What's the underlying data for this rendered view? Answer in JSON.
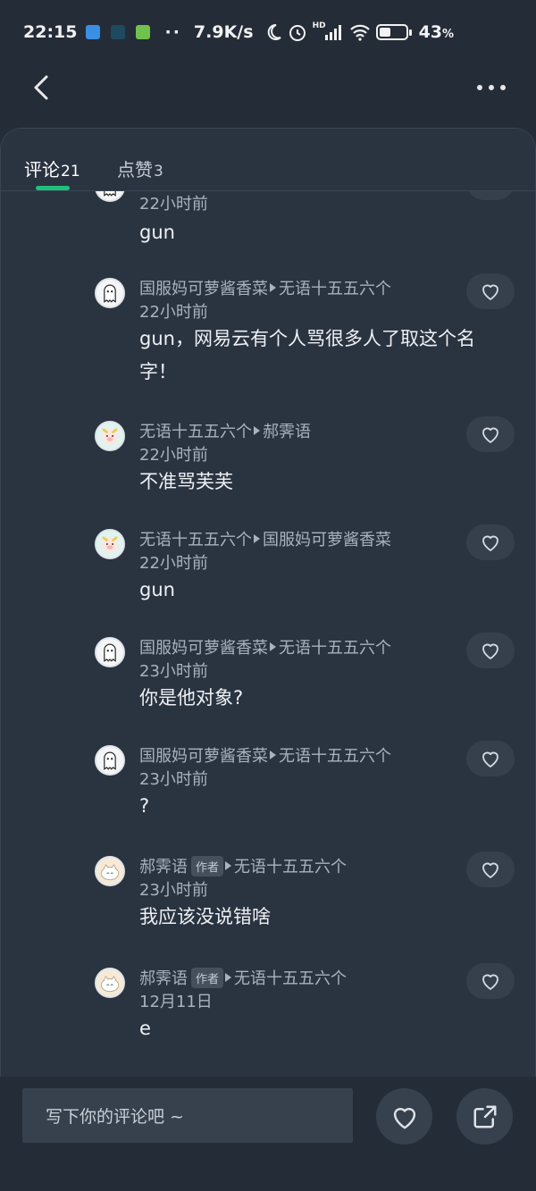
{
  "status_bar": {
    "time": "22:15",
    "net_speed": "7.9K/s",
    "battery_percent": "43",
    "battery_level": 0.43,
    "battery_suffix": "%",
    "hd_label": "HD",
    "icons": [
      "app-icon-1",
      "app-icon-2",
      "app-icon-3",
      "dots",
      "moon-icon",
      "alarm-icon",
      "signal-icon",
      "wifi-icon",
      "battery-icon"
    ]
  },
  "header": {
    "back_icon": "chevron-left-icon",
    "more_icon": "more-horizontal-icon"
  },
  "tabs": [
    {
      "label": "评论",
      "count": "21",
      "active": true
    },
    {
      "label": "点赞",
      "count": "3",
      "active": false
    }
  ],
  "comments": [
    {
      "author": "",
      "reply_to": "",
      "time": "22小时前",
      "text": "gun",
      "avatar": "ghost",
      "badge": ""
    },
    {
      "author": "国服妈可萝酱香菜",
      "reply_to": "无语十五五六个",
      "time": "22小时前",
      "text": "gun，网易云有个人骂很多人了取这个名字！",
      "avatar": "ghost",
      "badge": ""
    },
    {
      "author": "无语十五五六个",
      "reply_to": "郝霁语",
      "time": "22小时前",
      "text": "不准骂芙芙",
      "avatar": "pig",
      "badge": ""
    },
    {
      "author": "无语十五五六个",
      "reply_to": "国服妈可萝酱香菜",
      "time": "22小时前",
      "text": "gun",
      "avatar": "pig",
      "badge": ""
    },
    {
      "author": "国服妈可萝酱香菜",
      "reply_to": "无语十五五六个",
      "time": "23小时前",
      "text": "你是他对象?",
      "avatar": "ghost",
      "badge": ""
    },
    {
      "author": "国服妈可萝酱香菜",
      "reply_to": "无语十五五六个",
      "time": "23小时前",
      "text": "?",
      "avatar": "ghost",
      "badge": ""
    },
    {
      "author": "郝霁语",
      "reply_to": "无语十五五六个",
      "time": "23小时前",
      "text": "我应该没说错啥",
      "avatar": "cat",
      "badge": "作者"
    },
    {
      "author": "郝霁语",
      "reply_to": "无语十五五六个",
      "time": "12月11日",
      "text": "e",
      "avatar": "cat",
      "badge": "作者"
    }
  ],
  "bottom_bar": {
    "input_placeholder": "写下你的评论吧 ~",
    "like_icon": "heart-icon",
    "share_icon": "share-icon"
  },
  "colors": {
    "background": "#242c38",
    "panel": "#2a3340",
    "accent": "#1fc07d",
    "secondary_text": "#a9b2be"
  }
}
